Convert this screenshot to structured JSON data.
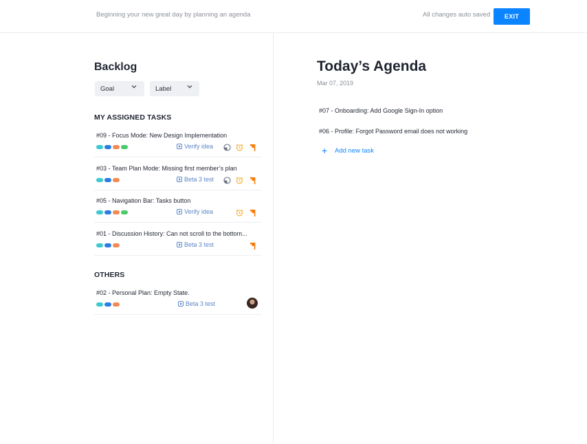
{
  "header": {
    "tagline": "Beginning your new great day by planning an agenda",
    "saved_status": "All changes auto saved",
    "exit_label": "EXIT"
  },
  "backlog": {
    "title": "Backlog",
    "filters": [
      {
        "label": "Goal"
      },
      {
        "label": "Label"
      }
    ],
    "assigned_heading": "MY ASSIGNED TASKS",
    "assigned_tasks": [
      {
        "title": "#09 - Focus Mode: New Design Implementation",
        "label": "Verify idea",
        "pills": [
          "#3fc9cf",
          "#2a7de1",
          "#f28a55",
          "#4cc96a"
        ],
        "icons": [
          "pie-chart-icon",
          "alarm-clock-icon",
          "flag-icon"
        ]
      },
      {
        "title": "#03 - Team Plan Mode: Missing first member’s plan",
        "label": "Beta 3 test",
        "pills": [
          "#3fc9cf",
          "#2a7de1",
          "#f28a55"
        ],
        "icons": [
          "pie-chart-icon",
          "alarm-clock-icon",
          "flag-icon"
        ]
      },
      {
        "title": "#05 - Navigation Bar: Tasks button",
        "label": "Verify idea",
        "pills": [
          "#3fc9cf",
          "#2a7de1",
          "#f28a55",
          "#4cc96a"
        ],
        "icons": [
          "alarm-clock-icon",
          "flag-icon"
        ]
      },
      {
        "title": "#01 - Discussion History: Can not scroll to the bottom...",
        "label": "Beta 3 test",
        "pills": [
          "#3fc9cf",
          "#2a7de1",
          "#f28a55"
        ],
        "icons": [
          "flag-icon"
        ]
      }
    ],
    "others_heading": "OTHERS",
    "other_tasks": [
      {
        "title": "#02 - Personal Plan: Empty State.",
        "label": "Beta 3 test",
        "pills": [
          "#3fc9cf",
          "#2a7de1",
          "#f28a55"
        ],
        "icons": [
          "avatar"
        ]
      }
    ]
  },
  "agenda": {
    "title": "Today’s Agenda",
    "date": "Mar 07, 2019",
    "items": [
      "#07 - Onboarding: Add Google Sign-In option",
      "#06 - Profile: Forgot Password email does not working"
    ],
    "add_task_label": "Add new task"
  },
  "colors": {
    "accent": "#0a84ff",
    "label_blue": "#5a86c4",
    "alarm_orange": "#f5a623",
    "flag_orange": "#f57c0b",
    "pie_gray": "#6c7080"
  }
}
